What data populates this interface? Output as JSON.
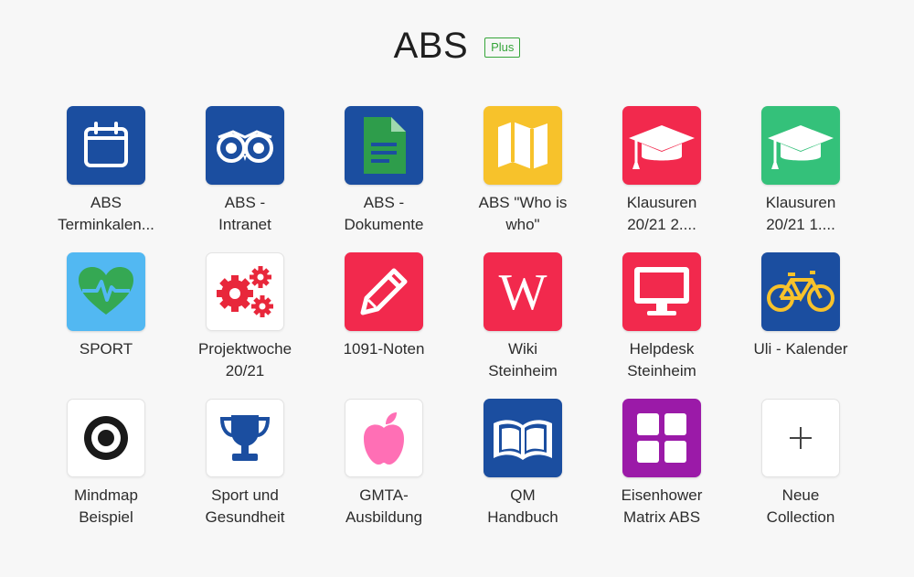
{
  "header": {
    "title": "ABS",
    "badge": "Plus"
  },
  "tiles": [
    {
      "name": "tile-abs-terminkalender",
      "icon": "calendar-icon",
      "color": "#1b4ea0",
      "line1": "ABS",
      "line2": "Terminkalen..."
    },
    {
      "name": "tile-abs-intranet",
      "icon": "owl-eyes-icon",
      "color": "#1b4ea0",
      "line1": "ABS -",
      "line2": "Intranet"
    },
    {
      "name": "tile-abs-dokumente",
      "icon": "document-icon",
      "color": "#1b4ea0",
      "line1": "ABS -",
      "line2": "Dokumente"
    },
    {
      "name": "tile-abs-who-is-who",
      "icon": "map-icon",
      "color": "#f7c22b",
      "line1": "ABS \"Who is",
      "line2": "who\""
    },
    {
      "name": "tile-klausuren-2",
      "icon": "graduation-cap-icon",
      "color": "#f2294d",
      "line1": "Klausuren",
      "line2": "20/21 2...."
    },
    {
      "name": "tile-klausuren-1",
      "icon": "graduation-cap-icon",
      "color": "#34c17a",
      "line1": "Klausuren",
      "line2": "20/21 1...."
    },
    {
      "name": "tile-sport",
      "icon": "heart-pulse-icon",
      "color": "#52b8f2",
      "line1": "SPORT",
      "line2": ""
    },
    {
      "name": "tile-projektwoche",
      "icon": "gears-icon",
      "color": "#ffffff",
      "line1": "Projektwoche",
      "line2": "20/21"
    },
    {
      "name": "tile-1091-noten",
      "icon": "pencil-icon",
      "color": "#f2294d",
      "line1": "1091-Noten",
      "line2": ""
    },
    {
      "name": "tile-wiki-steinheim",
      "icon": "wikipedia-icon",
      "color": "#f2294d",
      "line1": "Wiki",
      "line2": "Steinheim"
    },
    {
      "name": "tile-helpdesk-steinheim",
      "icon": "monitor-icon",
      "color": "#f2294d",
      "line1": "Helpdesk",
      "line2": "Steinheim"
    },
    {
      "name": "tile-uli-kalender",
      "icon": "bicycle-icon",
      "color": "#1b4ea0",
      "line1": "Uli - Kalender",
      "line2": ""
    },
    {
      "name": "tile-mindmap-beispiel",
      "icon": "target-icon",
      "color": "#ffffff",
      "line1": "Mindmap",
      "line2": "Beispiel"
    },
    {
      "name": "tile-sport-und-gesundheit",
      "icon": "trophy-icon",
      "color": "#ffffff",
      "line1": "Sport und",
      "line2": "Gesundheit"
    },
    {
      "name": "tile-gmta-ausbildung",
      "icon": "apple-icon",
      "color": "#ffffff",
      "line1": "GMTA-",
      "line2": "Ausbildung"
    },
    {
      "name": "tile-qm-handbuch",
      "icon": "open-book-icon",
      "color": "#1b4ea0",
      "line1": "QM",
      "line2": "Handbuch"
    },
    {
      "name": "tile-eisenhower-matrix",
      "icon": "grid-squares-icon",
      "color": "#9b1aa8",
      "line1": "Eisenhower",
      "line2": "Matrix ABS"
    },
    {
      "name": "tile-neue-collection",
      "icon": "plus-icon",
      "color": "#ffffff",
      "line1": "Neue",
      "line2": "Collection"
    }
  ]
}
